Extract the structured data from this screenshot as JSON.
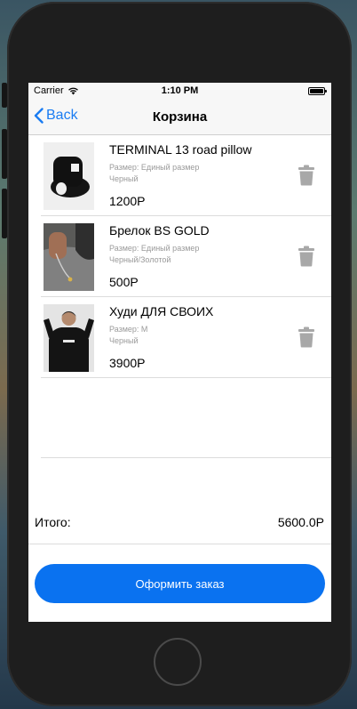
{
  "status_bar": {
    "carrier": "Carrier",
    "time": "1:10 PM"
  },
  "nav": {
    "back_label": "Back",
    "title": "Корзина"
  },
  "items": [
    {
      "name": "TERMINAL 13 road pillow",
      "size": "Размер: Единый размер",
      "color": "Черный",
      "price": "1200Р"
    },
    {
      "name": "Брелок BS GOLD",
      "size": "Размер: Единый размер",
      "color": "Черный/Золотой",
      "price": "500Р"
    },
    {
      "name": "Худи ДЛЯ СВОИХ",
      "size": "Размер: M",
      "color": "Черный",
      "price": "3900Р"
    }
  ],
  "summary": {
    "total_label": "Итого:",
    "total_value": "5600.0Р"
  },
  "checkout_label": "Оформить заказ",
  "colors": {
    "accent": "#0a72f0",
    "link": "#1a7cf2",
    "trash": "#a8a8a8"
  },
  "icons": [
    "wifi-icon",
    "battery-icon",
    "chevron-left-icon",
    "trash-icon"
  ]
}
